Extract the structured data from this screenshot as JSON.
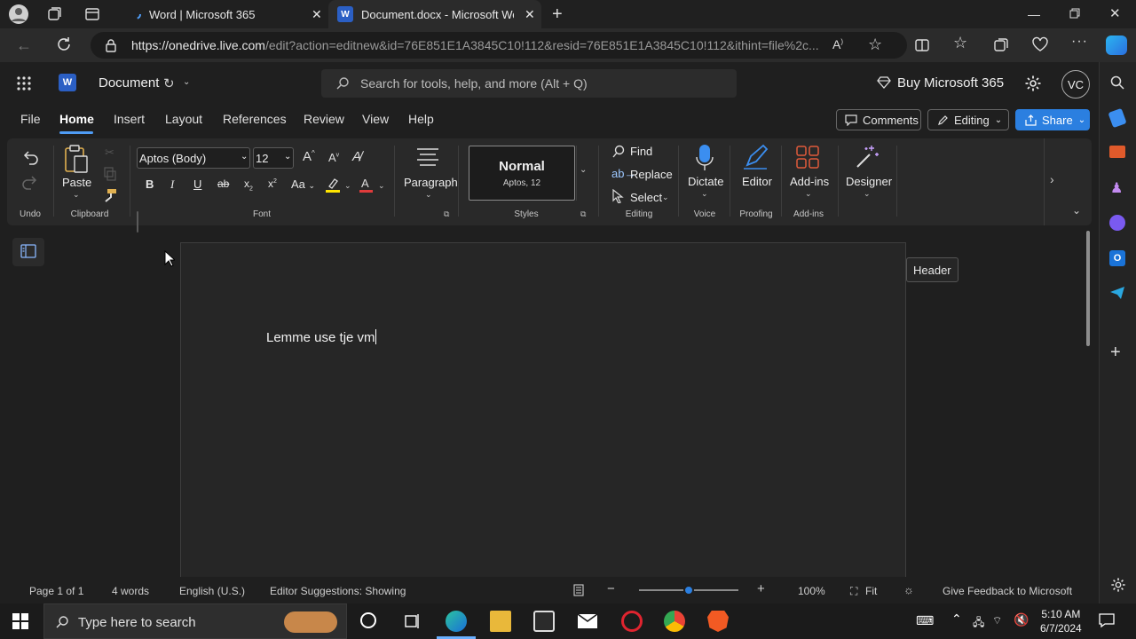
{
  "browser": {
    "tabs": [
      {
        "title": "Word | Microsoft 365"
      },
      {
        "title": "Document.docx - Microsoft Word"
      }
    ],
    "url_host": "https://onedrive.live.com",
    "url_path": "/edit?action=editnew&id=76E851E1A3845C10!112&resid=76E851E1A3845C10!112&ithint=file%2c..."
  },
  "word": {
    "doc_title": "Document",
    "search_placeholder": "Search for tools, help, and more (Alt + Q)",
    "buy_label": "Buy Microsoft 365",
    "avatar_initials": "VC",
    "menu": [
      "File",
      "Home",
      "Insert",
      "Layout",
      "References",
      "Review",
      "View",
      "Help"
    ],
    "comments_label": "Comments",
    "editing_label": "Editing",
    "share_label": "Share"
  },
  "ribbon": {
    "undo_group": "Undo",
    "paste_label": "Paste",
    "clipboard_group": "Clipboard",
    "font_name": "Aptos (Body)",
    "font_size": "12",
    "font_group": "Font",
    "paragraph_label": "Paragraph",
    "style_name": "Normal",
    "style_sub": "Aptos, 12",
    "styles_group": "Styles",
    "find_label": "Find",
    "replace_label": "Replace",
    "select_label": "Select",
    "editing_group": "Editing",
    "dictate_label": "Dictate",
    "voice_group": "Voice",
    "editor_label": "Editor",
    "proofing_group": "Proofing",
    "addins_label": "Add-ins",
    "addins_group": "Add-ins",
    "designer_label": "Designer"
  },
  "document": {
    "text": "Lemme use tje vm",
    "header_tooltip": "Header"
  },
  "status": {
    "page": "Page 1 of 1",
    "words": "4 words",
    "language": "English (U.S.)",
    "editor": "Editor Suggestions: Showing",
    "zoom": "100%",
    "fit": "Fit",
    "feedback": "Give Feedback to Microsoft",
    "zoom_level": 0.5
  },
  "taskbar": {
    "search_placeholder": "Type here to search",
    "time": "5:10 AM",
    "date": "6/7/2024"
  },
  "colors": {
    "accent": "#2b7fe0",
    "word_blue": "#2b5fc4",
    "highlight": "#ffe500",
    "font_color": "#e03b3b"
  }
}
